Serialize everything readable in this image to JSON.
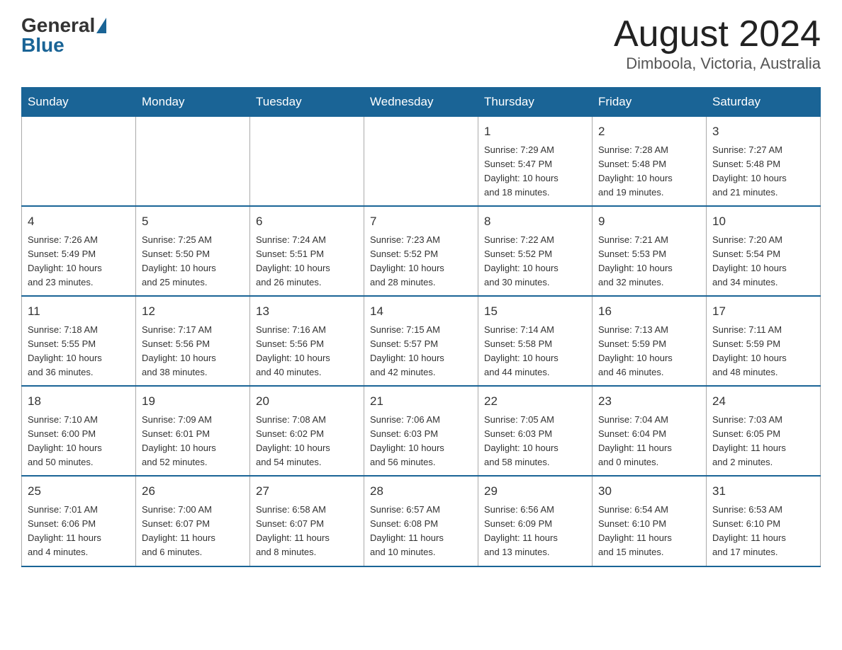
{
  "header": {
    "logo_general": "General",
    "logo_blue": "Blue",
    "month_year": "August 2024",
    "location": "Dimboola, Victoria, Australia"
  },
  "days_of_week": [
    "Sunday",
    "Monday",
    "Tuesday",
    "Wednesday",
    "Thursday",
    "Friday",
    "Saturday"
  ],
  "weeks": [
    [
      {
        "day": "",
        "info": ""
      },
      {
        "day": "",
        "info": ""
      },
      {
        "day": "",
        "info": ""
      },
      {
        "day": "",
        "info": ""
      },
      {
        "day": "1",
        "info": "Sunrise: 7:29 AM\nSunset: 5:47 PM\nDaylight: 10 hours\nand 18 minutes."
      },
      {
        "day": "2",
        "info": "Sunrise: 7:28 AM\nSunset: 5:48 PM\nDaylight: 10 hours\nand 19 minutes."
      },
      {
        "day": "3",
        "info": "Sunrise: 7:27 AM\nSunset: 5:48 PM\nDaylight: 10 hours\nand 21 minutes."
      }
    ],
    [
      {
        "day": "4",
        "info": "Sunrise: 7:26 AM\nSunset: 5:49 PM\nDaylight: 10 hours\nand 23 minutes."
      },
      {
        "day": "5",
        "info": "Sunrise: 7:25 AM\nSunset: 5:50 PM\nDaylight: 10 hours\nand 25 minutes."
      },
      {
        "day": "6",
        "info": "Sunrise: 7:24 AM\nSunset: 5:51 PM\nDaylight: 10 hours\nand 26 minutes."
      },
      {
        "day": "7",
        "info": "Sunrise: 7:23 AM\nSunset: 5:52 PM\nDaylight: 10 hours\nand 28 minutes."
      },
      {
        "day": "8",
        "info": "Sunrise: 7:22 AM\nSunset: 5:52 PM\nDaylight: 10 hours\nand 30 minutes."
      },
      {
        "day": "9",
        "info": "Sunrise: 7:21 AM\nSunset: 5:53 PM\nDaylight: 10 hours\nand 32 minutes."
      },
      {
        "day": "10",
        "info": "Sunrise: 7:20 AM\nSunset: 5:54 PM\nDaylight: 10 hours\nand 34 minutes."
      }
    ],
    [
      {
        "day": "11",
        "info": "Sunrise: 7:18 AM\nSunset: 5:55 PM\nDaylight: 10 hours\nand 36 minutes."
      },
      {
        "day": "12",
        "info": "Sunrise: 7:17 AM\nSunset: 5:56 PM\nDaylight: 10 hours\nand 38 minutes."
      },
      {
        "day": "13",
        "info": "Sunrise: 7:16 AM\nSunset: 5:56 PM\nDaylight: 10 hours\nand 40 minutes."
      },
      {
        "day": "14",
        "info": "Sunrise: 7:15 AM\nSunset: 5:57 PM\nDaylight: 10 hours\nand 42 minutes."
      },
      {
        "day": "15",
        "info": "Sunrise: 7:14 AM\nSunset: 5:58 PM\nDaylight: 10 hours\nand 44 minutes."
      },
      {
        "day": "16",
        "info": "Sunrise: 7:13 AM\nSunset: 5:59 PM\nDaylight: 10 hours\nand 46 minutes."
      },
      {
        "day": "17",
        "info": "Sunrise: 7:11 AM\nSunset: 5:59 PM\nDaylight: 10 hours\nand 48 minutes."
      }
    ],
    [
      {
        "day": "18",
        "info": "Sunrise: 7:10 AM\nSunset: 6:00 PM\nDaylight: 10 hours\nand 50 minutes."
      },
      {
        "day": "19",
        "info": "Sunrise: 7:09 AM\nSunset: 6:01 PM\nDaylight: 10 hours\nand 52 minutes."
      },
      {
        "day": "20",
        "info": "Sunrise: 7:08 AM\nSunset: 6:02 PM\nDaylight: 10 hours\nand 54 minutes."
      },
      {
        "day": "21",
        "info": "Sunrise: 7:06 AM\nSunset: 6:03 PM\nDaylight: 10 hours\nand 56 minutes."
      },
      {
        "day": "22",
        "info": "Sunrise: 7:05 AM\nSunset: 6:03 PM\nDaylight: 10 hours\nand 58 minutes."
      },
      {
        "day": "23",
        "info": "Sunrise: 7:04 AM\nSunset: 6:04 PM\nDaylight: 11 hours\nand 0 minutes."
      },
      {
        "day": "24",
        "info": "Sunrise: 7:03 AM\nSunset: 6:05 PM\nDaylight: 11 hours\nand 2 minutes."
      }
    ],
    [
      {
        "day": "25",
        "info": "Sunrise: 7:01 AM\nSunset: 6:06 PM\nDaylight: 11 hours\nand 4 minutes."
      },
      {
        "day": "26",
        "info": "Sunrise: 7:00 AM\nSunset: 6:07 PM\nDaylight: 11 hours\nand 6 minutes."
      },
      {
        "day": "27",
        "info": "Sunrise: 6:58 AM\nSunset: 6:07 PM\nDaylight: 11 hours\nand 8 minutes."
      },
      {
        "day": "28",
        "info": "Sunrise: 6:57 AM\nSunset: 6:08 PM\nDaylight: 11 hours\nand 10 minutes."
      },
      {
        "day": "29",
        "info": "Sunrise: 6:56 AM\nSunset: 6:09 PM\nDaylight: 11 hours\nand 13 minutes."
      },
      {
        "day": "30",
        "info": "Sunrise: 6:54 AM\nSunset: 6:10 PM\nDaylight: 11 hours\nand 15 minutes."
      },
      {
        "day": "31",
        "info": "Sunrise: 6:53 AM\nSunset: 6:10 PM\nDaylight: 11 hours\nand 17 minutes."
      }
    ]
  ]
}
